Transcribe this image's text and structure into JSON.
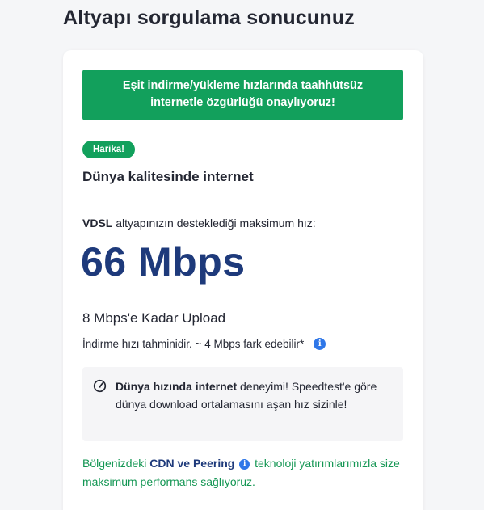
{
  "page": {
    "title": "Altyapı sorgulama sonucunuz"
  },
  "banner": {
    "text": "Eşit indirme/yükleme hızlarında taahhütsüz internetle özgürlüğü onaylıyoruz!"
  },
  "result": {
    "badge": "Harika!",
    "heading": "Dünya kalitesinde internet",
    "tech": "VDSL",
    "speed_desc": " altyapınızın desteklediği maksimum hız:",
    "speed_value": "66 Mbps",
    "upload": "8 Mbps'e Kadar Upload",
    "estimate": "İndirme hızı tahminidir. ~ 4 Mbps fark edebilir*"
  },
  "tip": {
    "icon": "speedometer-icon",
    "bold": "Dünya hızında internet",
    "text": " deneyimi! Speedtest'e göre dünya download ortalamasını aşan hız sizinle!"
  },
  "cdn": {
    "prefix": "Bölgenizdeki ",
    "bold": "CDN ve Peering",
    "suffix": " teknoloji yatırımlarımızla size maksimum performans sağlıyoruz."
  },
  "colors": {
    "accent_green": "#12a05c",
    "speed_blue": "#1e3a7b",
    "info_blue": "#2f77e8"
  }
}
